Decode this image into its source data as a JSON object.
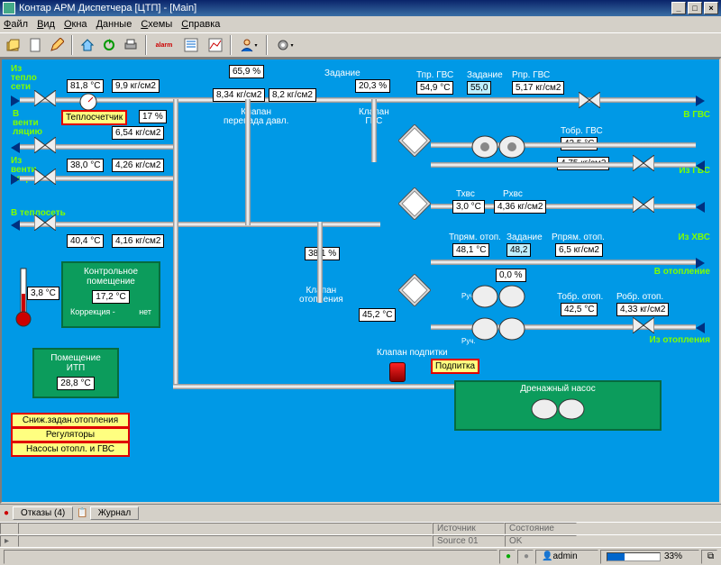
{
  "window": {
    "title": "Контар АРМ Диспетчера [ЦТП] - [Main]"
  },
  "menu": [
    "Файл",
    "Вид",
    "Окна",
    "Данные",
    "Схемы",
    "Справка"
  ],
  "canvas": {
    "left_labels": {
      "iz_teplo": "Из\nтепло\nсети",
      "v_venti": "В\nвенти\nляцию",
      "iz_venti": "Из\nвенти\nляции",
      "v_teploset": "В теплосеть"
    },
    "right_labels": {
      "v_gvs": "В ГВС",
      "iz_gvs": "Из ГВС",
      "iz_hvs": "Из ХВС",
      "v_otop": "В отопление",
      "iz_otop": "Из отопления"
    },
    "vals": {
      "t1": "81,8 °C",
      "p1": "9,9 кг/см2",
      "teploschet": "Теплосчетчик",
      "pct1": "17 %",
      "p2": "6,54 кг/см2",
      "t2": "38,0 °C",
      "p3": "4,26 кг/см2",
      "t3": "40,4 °C",
      "p4": "4,16 кг/см2",
      "pct_klapan": "65,9 %",
      "p_klap1": "8,34 кг/см2",
      "p_klap2": "8,2 кг/см2",
      "klapan_lbl": "Клапан\nперепада давл.",
      "zadanie": "Задание",
      "pct_gvs": "20,3 %",
      "klapan_gvs": "Клапан\nГВС",
      "tpr_gvs_l": "Тпр. ГВС",
      "tpr_gvs": "54,9 °C",
      "zad2_l": "Задание",
      "zad2": "55,0",
      "ppr_gvs_l": "Рпр. ГВС",
      "ppr_gvs": "5,17 кг/см2",
      "tobr_gvs_l": "Тобр. ГВС",
      "tobr_gvs": "42,5 °C",
      "p_gvs": "4,75 кг/см2",
      "thvs_l": "Тхвс",
      "thvs": "3,0 °C",
      "phvs_l": "Рхвс",
      "phvs": "4,36 кг/см2",
      "pct_otop": "38,1 %",
      "klapan_otop": "Клапан\nотопления",
      "t_otop": "45,2 °C",
      "tpr_otop_l": "Тпрям. отоп.",
      "tpr_otop": "48,1 °C",
      "zad3_l": "Задание",
      "zad3": "48,2",
      "ppr_otop_l": "Рпрям. отоп.",
      "ppr_otop": "6,5 кг/см2",
      "pct_zero": "0,0 %",
      "ruch1": "Руч.",
      "ruch2": "Руч.",
      "tobr_otop_l": "Тобр. отоп.",
      "tobr_otop": "42,5 °C",
      "pobr_otop_l": "Робр. отоп.",
      "pobr_otop": "4,33 кг/см2",
      "klapan_podpit": "Клапан подпитки",
      "podpitka": "Подпитка",
      "dren": "Дренажный насос",
      "t_room": "3,8 °C",
      "ctrl_room": "Контрольное\nпомещение",
      "t_ctrl": "17,2 °C",
      "korr": "Коррекция -",
      "net": "нет",
      "pomesh": "Помещение\nИТП",
      "t_itp": "28,8 °C",
      "btn1": "Сниж.задан.отопления",
      "btn2": "Регуляторы",
      "btn3": "Насосы отопл. и ГВС"
    }
  },
  "tabs": {
    "otk": "Отказы (4)",
    "zhur": "Журнал"
  },
  "grid": {
    "c1": "",
    "c2": "Источник",
    "c3": "Состояние",
    "r1": "Source 01",
    "r2": "OK"
  },
  "status": {
    "user": "admin",
    "pct": "33%"
  }
}
